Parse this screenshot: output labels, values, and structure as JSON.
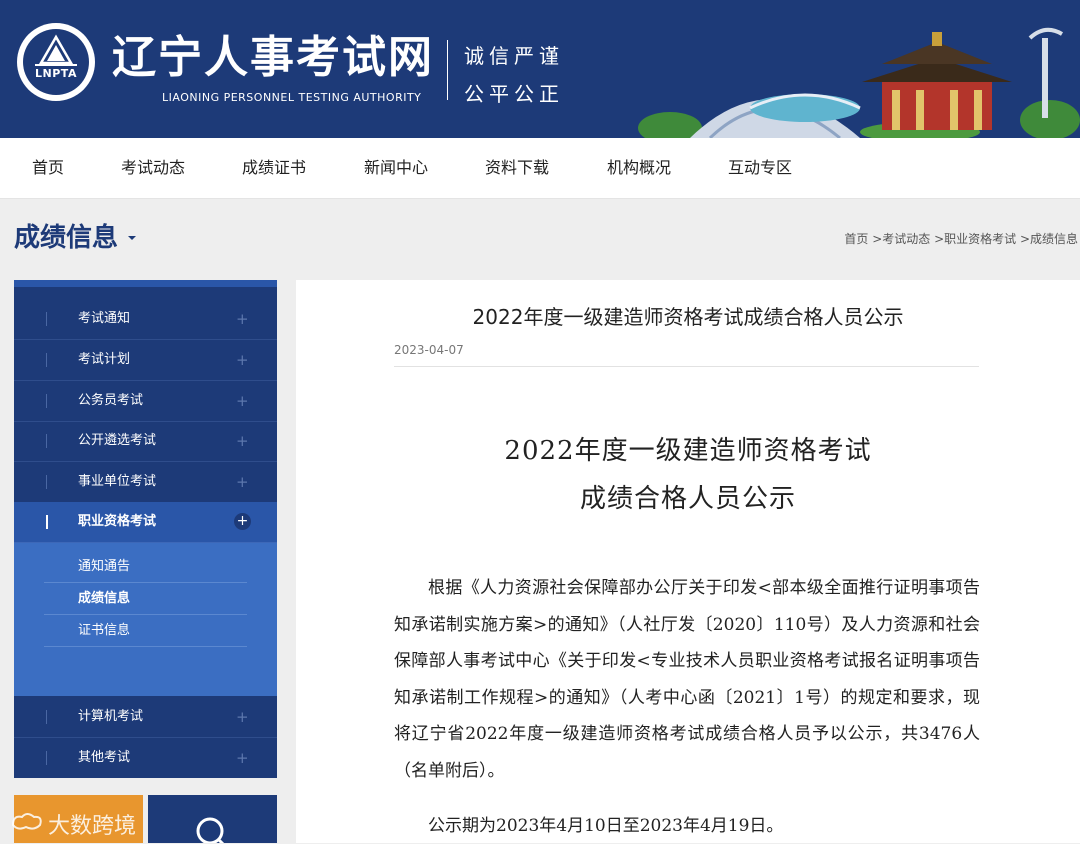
{
  "header": {
    "logo_abbr": "LNPTA",
    "site_title": "辽宁人事考试网",
    "site_subtitle": "LIAONING PERSONNEL TESTING AUTHORITY",
    "motto_line1": "诚信严谨",
    "motto_line2": "公平公正"
  },
  "nav": {
    "items": [
      "首页",
      "考试动态",
      "成绩证书",
      "新闻中心",
      "资料下载",
      "机构概况",
      "互动专区"
    ]
  },
  "section": {
    "title": "成绩信息",
    "breadcrumb": "首页 >考试动态 >职业资格考试 >成绩信息"
  },
  "sidebar": {
    "items": [
      "考试通知",
      "考试计划",
      "公务员考试",
      "公开遴选考试",
      "事业单位考试",
      "职业资格考试",
      "计算机考试",
      "其他考试"
    ],
    "active_item": "职业资格考试",
    "sub_items": [
      "通知通告",
      "成绩信息",
      "证书信息"
    ],
    "plus_symbol": "+"
  },
  "watermark": {
    "text": "大数跨境"
  },
  "article": {
    "title": "2022年度一级建造师资格考试成绩合格人员公示",
    "date": "2023-04-07",
    "heading_line1": "2022年度一级建造师资格考试",
    "heading_line2": "成绩合格人员公示",
    "paragraph1": "根据《人力资源社会保障部办公厅关于印发<部本级全面推行证明事项告知承诺制实施方案>的通知》（人社厅发〔2020〕110号）及人力资源和社会保障部人事考试中心《关于印发<专业技术人员职业资格考试报名证明事项告知承诺制工作规程>的通知》（人考中心函〔2021〕1号）的规定和要求，现将辽宁省2022年度一级建造师资格考试成绩合格人员予以公示，共3476人（名单附后）。",
    "paragraph2": "公示期为2023年4月10日至2023年4月19日。"
  },
  "colors": {
    "brand_navy": "#1d3a78",
    "active_blue": "#2a56a8",
    "submenu_blue": "#3b6ec2",
    "tile_orange": "#e8962e"
  }
}
